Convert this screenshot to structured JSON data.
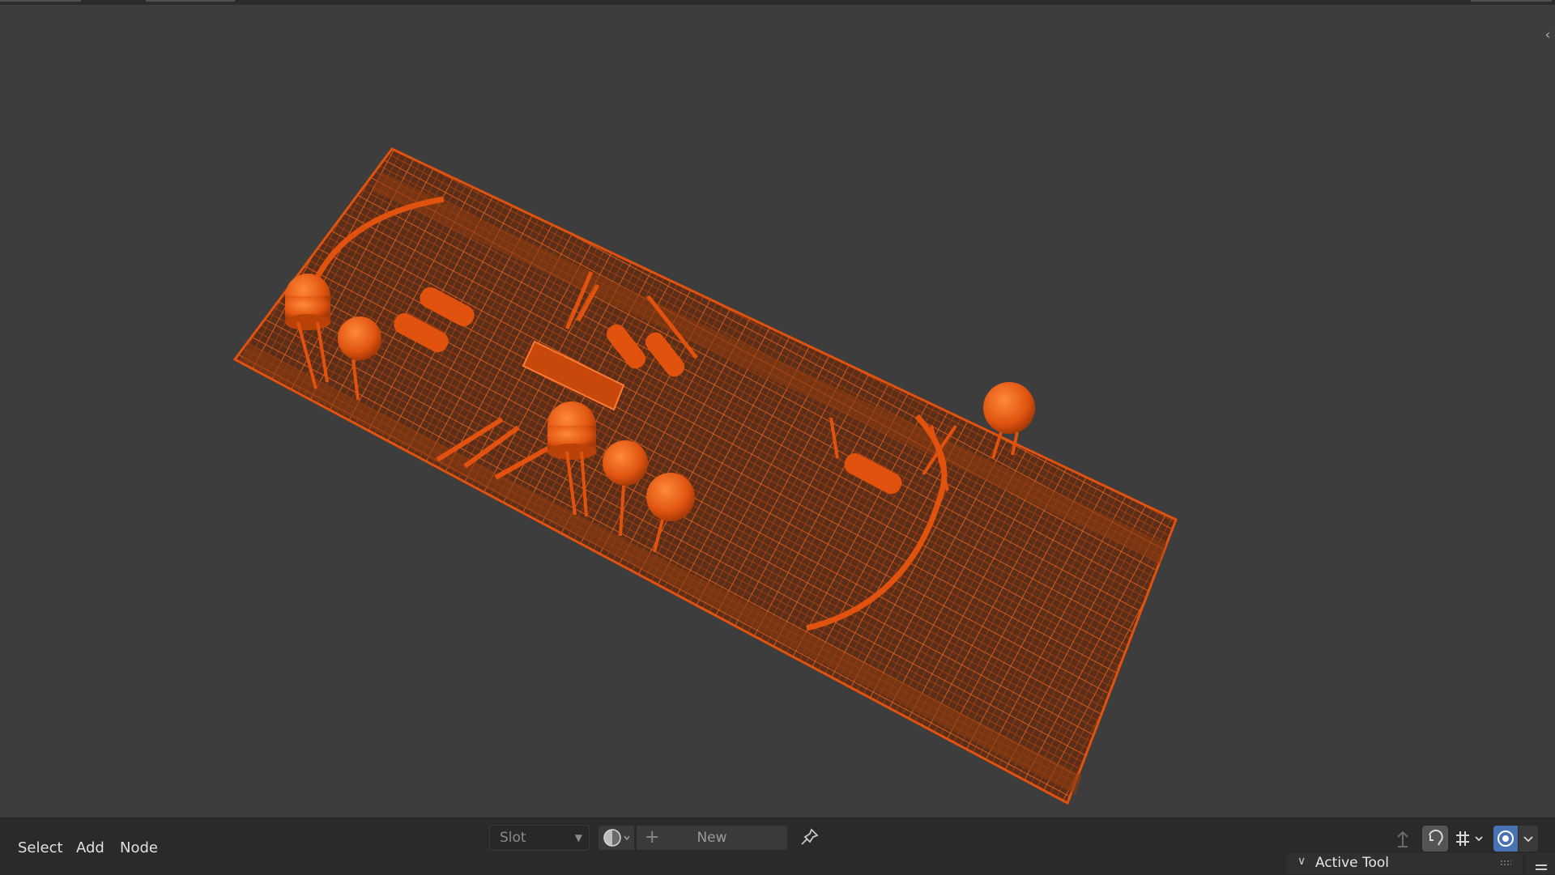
{
  "header": {
    "menus": [
      "Select",
      "Add",
      "Node"
    ],
    "slot": {
      "value": "Slot"
    },
    "material": {
      "new_label": "New",
      "plus": "+"
    }
  },
  "panel": {
    "title": "Active Tool"
  },
  "icons": {
    "slot_chevron": "chevron-down-icon",
    "material_ball": "material-sphere-icon",
    "pin": "pin-icon",
    "collapse": "chevron-left-icon"
  },
  "colors": {
    "viewport_bg": "#3d3d3d",
    "header_bg": "#2a2a2a",
    "wire": "#e0520e",
    "accent": "#4772b3"
  }
}
